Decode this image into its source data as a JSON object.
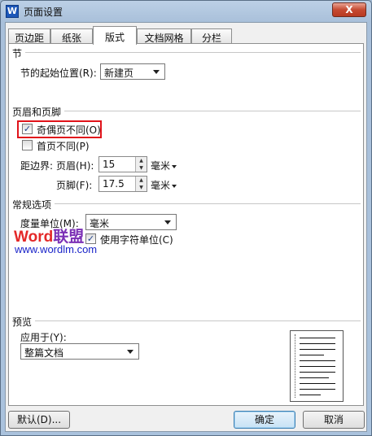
{
  "window": {
    "title": "页面设置",
    "close_label": "X",
    "app_icon_label": "W"
  },
  "tabs": [
    {
      "label": "页边距",
      "active": false
    },
    {
      "label": "纸张",
      "active": false
    },
    {
      "label": "版式",
      "active": true
    },
    {
      "label": "文档网格",
      "active": false
    },
    {
      "label": "分栏",
      "active": false
    }
  ],
  "section": {
    "title": "节",
    "start_label": "节的起始位置(R):",
    "start_value": "新建页"
  },
  "header_footer": {
    "title": "页眉和页脚",
    "odd_even": {
      "label": "奇偶页不同(O)",
      "checked": true
    },
    "first_page": {
      "label": "首页不同(P)",
      "checked": false
    },
    "distance_label": "距边界:",
    "header_label": "页眉(H):",
    "header_value": "15",
    "footer_label": "页脚(F):",
    "footer_value": "17.5",
    "unit": "毫米"
  },
  "general": {
    "title": "常规选项",
    "measure_label": "度量单位(M):",
    "measure_value": "毫米",
    "char_unit": {
      "label": "使用字符单位(C)",
      "checked": true
    }
  },
  "watermark": {
    "word": "Word",
    "cn": "联盟",
    "url": "www.wordlm.com"
  },
  "preview": {
    "title": "预览",
    "apply_label": "应用于(Y):",
    "apply_value": "整篇文档"
  },
  "buttons": {
    "default": "默认(D)...",
    "ok": "确定",
    "cancel": "取消"
  },
  "colors": {
    "highlight": "#e0131a",
    "watermark_word": "#e42828",
    "watermark_cn": "#7b2fb5",
    "watermark_url": "#1a24c9"
  }
}
